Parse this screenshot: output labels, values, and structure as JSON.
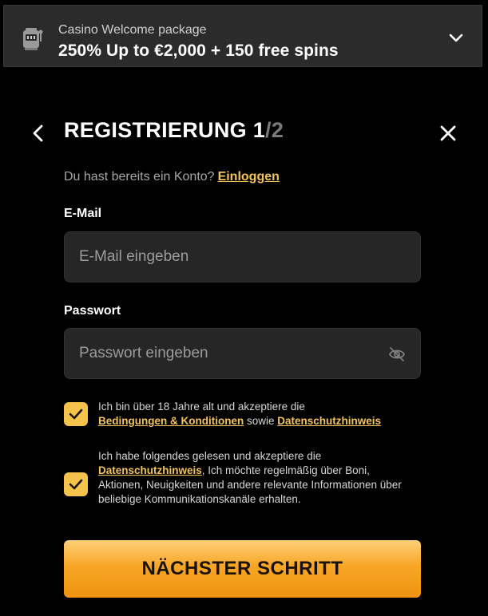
{
  "promo": {
    "subtitle": "Casino Welcome package",
    "title": "250% Up to €2,000 + 150 free spins",
    "icon": "slot-machine-icon"
  },
  "header": {
    "title": "REGISTRIERUNG 1",
    "separator": "/",
    "total": "2"
  },
  "login": {
    "prompt": "Du hast bereits ein Konto?",
    "link": "Einloggen"
  },
  "email": {
    "label": "E-Mail",
    "placeholder": "E-Mail eingeben",
    "value": ""
  },
  "password": {
    "label": "Passwort",
    "placeholder": "Passwort eingeben",
    "value": ""
  },
  "consent_terms": {
    "checked": true,
    "text_1": "Ich bin über 18 Jahre alt und akzeptiere die",
    "link_terms": "Bedingungen & Konditionen",
    "text_2": "sowie",
    "link_privacy": "Datenschutzhinweis"
  },
  "consent_marketing": {
    "checked": true,
    "text_1": "Ich habe folgendes gelesen und akzeptiere die",
    "link_privacy": "Datenschutzhinweis",
    "text_2": ", Ich möchte regelmäßig über Boni, Aktionen, Neuigkeiten und andere relevante Informationen über beliebige Kommunikationskanäle erhalten."
  },
  "next_button": {
    "label": "NÄCHSTER SCHRITT"
  },
  "colors": {
    "accent": "#f5c24c",
    "background": "#000000",
    "field": "#262626",
    "button_top": "#ffd07a",
    "button_bottom": "#ef9313"
  }
}
